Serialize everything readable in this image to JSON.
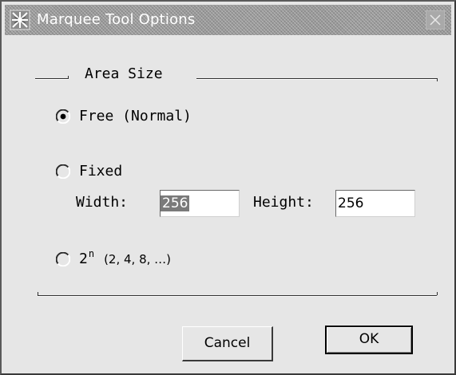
{
  "window": {
    "title": "Marquee Tool Options"
  },
  "group": {
    "title": "Area Size"
  },
  "options": {
    "free_label": "Free (Normal)",
    "fixed_label": "Fixed",
    "power_base": "2",
    "power_exp": "n",
    "power_examples": "(2, 4, 8, …)",
    "selected": "free"
  },
  "fixed": {
    "width_label": "Width:",
    "width_value": "256",
    "height_label": "Height:",
    "height_value": "256"
  },
  "buttons": {
    "cancel": "Cancel",
    "ok": "OK"
  },
  "icons": {
    "title_icon": "marquee-tool-icon",
    "close": "close-icon"
  }
}
